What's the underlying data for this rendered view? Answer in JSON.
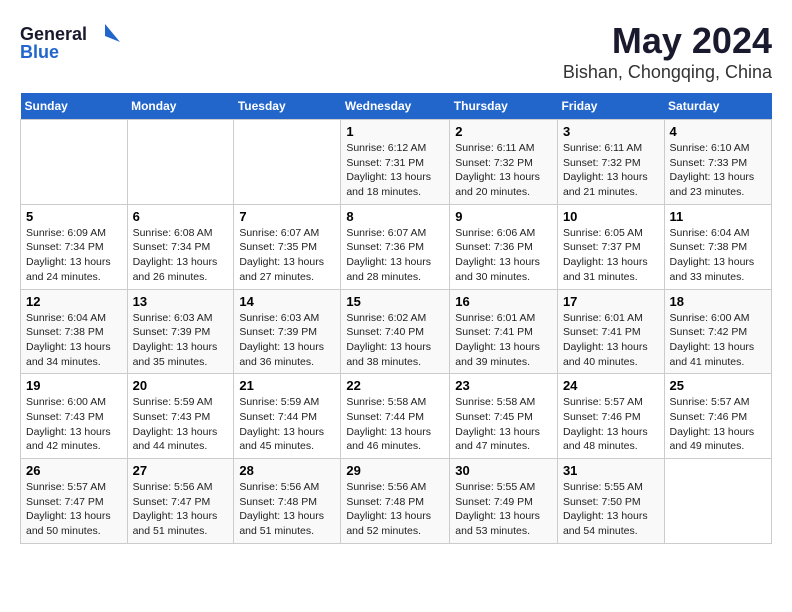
{
  "header": {
    "logo_general": "General",
    "logo_blue": "Blue",
    "title": "May 2024",
    "subtitle": "Bishan, Chongqing, China"
  },
  "days_of_week": [
    "Sunday",
    "Monday",
    "Tuesday",
    "Wednesday",
    "Thursday",
    "Friday",
    "Saturday"
  ],
  "weeks": [
    {
      "cells": [
        {
          "day": "",
          "empty": true
        },
        {
          "day": "",
          "empty": true
        },
        {
          "day": "",
          "empty": true
        },
        {
          "day": "1",
          "sunrise": "6:12 AM",
          "sunset": "7:31 PM",
          "daylight": "13 hours and 18 minutes."
        },
        {
          "day": "2",
          "sunrise": "6:11 AM",
          "sunset": "7:32 PM",
          "daylight": "13 hours and 20 minutes."
        },
        {
          "day": "3",
          "sunrise": "6:11 AM",
          "sunset": "7:32 PM",
          "daylight": "13 hours and 21 minutes."
        },
        {
          "day": "4",
          "sunrise": "6:10 AM",
          "sunset": "7:33 PM",
          "daylight": "13 hours and 23 minutes."
        }
      ]
    },
    {
      "cells": [
        {
          "day": "5",
          "sunrise": "6:09 AM",
          "sunset": "7:34 PM",
          "daylight": "13 hours and 24 minutes."
        },
        {
          "day": "6",
          "sunrise": "6:08 AM",
          "sunset": "7:34 PM",
          "daylight": "13 hours and 26 minutes."
        },
        {
          "day": "7",
          "sunrise": "6:07 AM",
          "sunset": "7:35 PM",
          "daylight": "13 hours and 27 minutes."
        },
        {
          "day": "8",
          "sunrise": "6:07 AM",
          "sunset": "7:36 PM",
          "daylight": "13 hours and 28 minutes."
        },
        {
          "day": "9",
          "sunrise": "6:06 AM",
          "sunset": "7:36 PM",
          "daylight": "13 hours and 30 minutes."
        },
        {
          "day": "10",
          "sunrise": "6:05 AM",
          "sunset": "7:37 PM",
          "daylight": "13 hours and 31 minutes."
        },
        {
          "day": "11",
          "sunrise": "6:04 AM",
          "sunset": "7:38 PM",
          "daylight": "13 hours and 33 minutes."
        }
      ]
    },
    {
      "cells": [
        {
          "day": "12",
          "sunrise": "6:04 AM",
          "sunset": "7:38 PM",
          "daylight": "13 hours and 34 minutes."
        },
        {
          "day": "13",
          "sunrise": "6:03 AM",
          "sunset": "7:39 PM",
          "daylight": "13 hours and 35 minutes."
        },
        {
          "day": "14",
          "sunrise": "6:03 AM",
          "sunset": "7:39 PM",
          "daylight": "13 hours and 36 minutes."
        },
        {
          "day": "15",
          "sunrise": "6:02 AM",
          "sunset": "7:40 PM",
          "daylight": "13 hours and 38 minutes."
        },
        {
          "day": "16",
          "sunrise": "6:01 AM",
          "sunset": "7:41 PM",
          "daylight": "13 hours and 39 minutes."
        },
        {
          "day": "17",
          "sunrise": "6:01 AM",
          "sunset": "7:41 PM",
          "daylight": "13 hours and 40 minutes."
        },
        {
          "day": "18",
          "sunrise": "6:00 AM",
          "sunset": "7:42 PM",
          "daylight": "13 hours and 41 minutes."
        }
      ]
    },
    {
      "cells": [
        {
          "day": "19",
          "sunrise": "6:00 AM",
          "sunset": "7:43 PM",
          "daylight": "13 hours and 42 minutes."
        },
        {
          "day": "20",
          "sunrise": "5:59 AM",
          "sunset": "7:43 PM",
          "daylight": "13 hours and 44 minutes."
        },
        {
          "day": "21",
          "sunrise": "5:59 AM",
          "sunset": "7:44 PM",
          "daylight": "13 hours and 45 minutes."
        },
        {
          "day": "22",
          "sunrise": "5:58 AM",
          "sunset": "7:44 PM",
          "daylight": "13 hours and 46 minutes."
        },
        {
          "day": "23",
          "sunrise": "5:58 AM",
          "sunset": "7:45 PM",
          "daylight": "13 hours and 47 minutes."
        },
        {
          "day": "24",
          "sunrise": "5:57 AM",
          "sunset": "7:46 PM",
          "daylight": "13 hours and 48 minutes."
        },
        {
          "day": "25",
          "sunrise": "5:57 AM",
          "sunset": "7:46 PM",
          "daylight": "13 hours and 49 minutes."
        }
      ]
    },
    {
      "cells": [
        {
          "day": "26",
          "sunrise": "5:57 AM",
          "sunset": "7:47 PM",
          "daylight": "13 hours and 50 minutes."
        },
        {
          "day": "27",
          "sunrise": "5:56 AM",
          "sunset": "7:47 PM",
          "daylight": "13 hours and 51 minutes."
        },
        {
          "day": "28",
          "sunrise": "5:56 AM",
          "sunset": "7:48 PM",
          "daylight": "13 hours and 51 minutes."
        },
        {
          "day": "29",
          "sunrise": "5:56 AM",
          "sunset": "7:48 PM",
          "daylight": "13 hours and 52 minutes."
        },
        {
          "day": "30",
          "sunrise": "5:55 AM",
          "sunset": "7:49 PM",
          "daylight": "13 hours and 53 minutes."
        },
        {
          "day": "31",
          "sunrise": "5:55 AM",
          "sunset": "7:50 PM",
          "daylight": "13 hours and 54 minutes."
        },
        {
          "day": "",
          "empty": true
        }
      ]
    }
  ],
  "labels": {
    "sunrise": "Sunrise:",
    "sunset": "Sunset:",
    "daylight": "Daylight:"
  }
}
